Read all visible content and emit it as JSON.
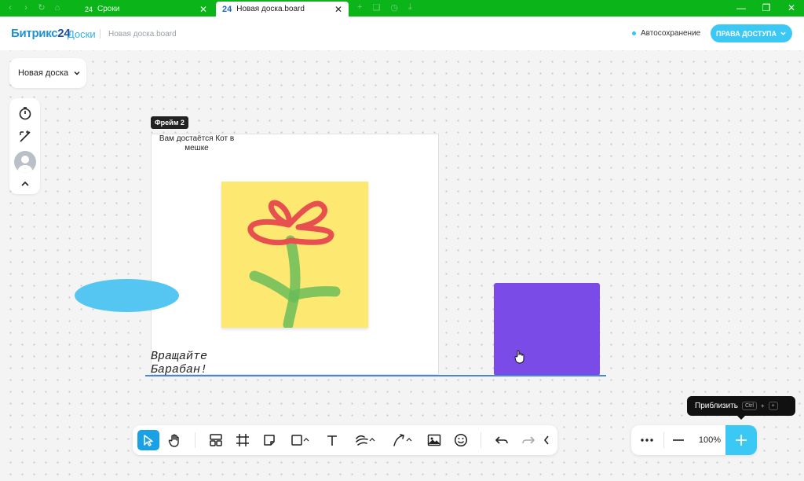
{
  "browser": {
    "tabs": [
      {
        "label": "Сроки",
        "favicon": "24"
      },
      {
        "label": "Новая доска.board",
        "favicon": "24"
      }
    ]
  },
  "header": {
    "logo_main": "Битрикс",
    "logo_num": "24",
    "logo_suffix": "Доски",
    "doc_title": "Новая доска.board",
    "autosave": "Автосохранение",
    "access_button": "ПРАВА ДОСТУПА"
  },
  "sidebar": {
    "board_dropdown": "Новая доска"
  },
  "canvas": {
    "frame_label": "Фрейм 2",
    "frame_text": "Вам достаётся Кот в мешке",
    "spin_text": "Вращайте\nБарабан!"
  },
  "zoom": {
    "level": "100%",
    "tooltip": "Приблизить",
    "tooltip_key1": "Ctrl",
    "tooltip_key2": "+",
    "tooltip_key3": "+"
  },
  "colors": {
    "accent": "#3bc8f5",
    "tab_bar": "#0bb418",
    "sticky": "#fde872",
    "ellipse": "#55c5f2",
    "rectangle": "#7b4be8",
    "flower_petals": "#e8504f",
    "flower_stem": "#6bbd5b"
  },
  "toolbar_icons": [
    "select-icon",
    "hand-icon",
    "templates-icon",
    "frame-icon",
    "sticky-note-icon",
    "shape-icon",
    "text-icon",
    "pen-icon",
    "connector-icon",
    "image-icon",
    "emoji-icon",
    "undo-icon",
    "redo-icon",
    "collapse-icon"
  ]
}
